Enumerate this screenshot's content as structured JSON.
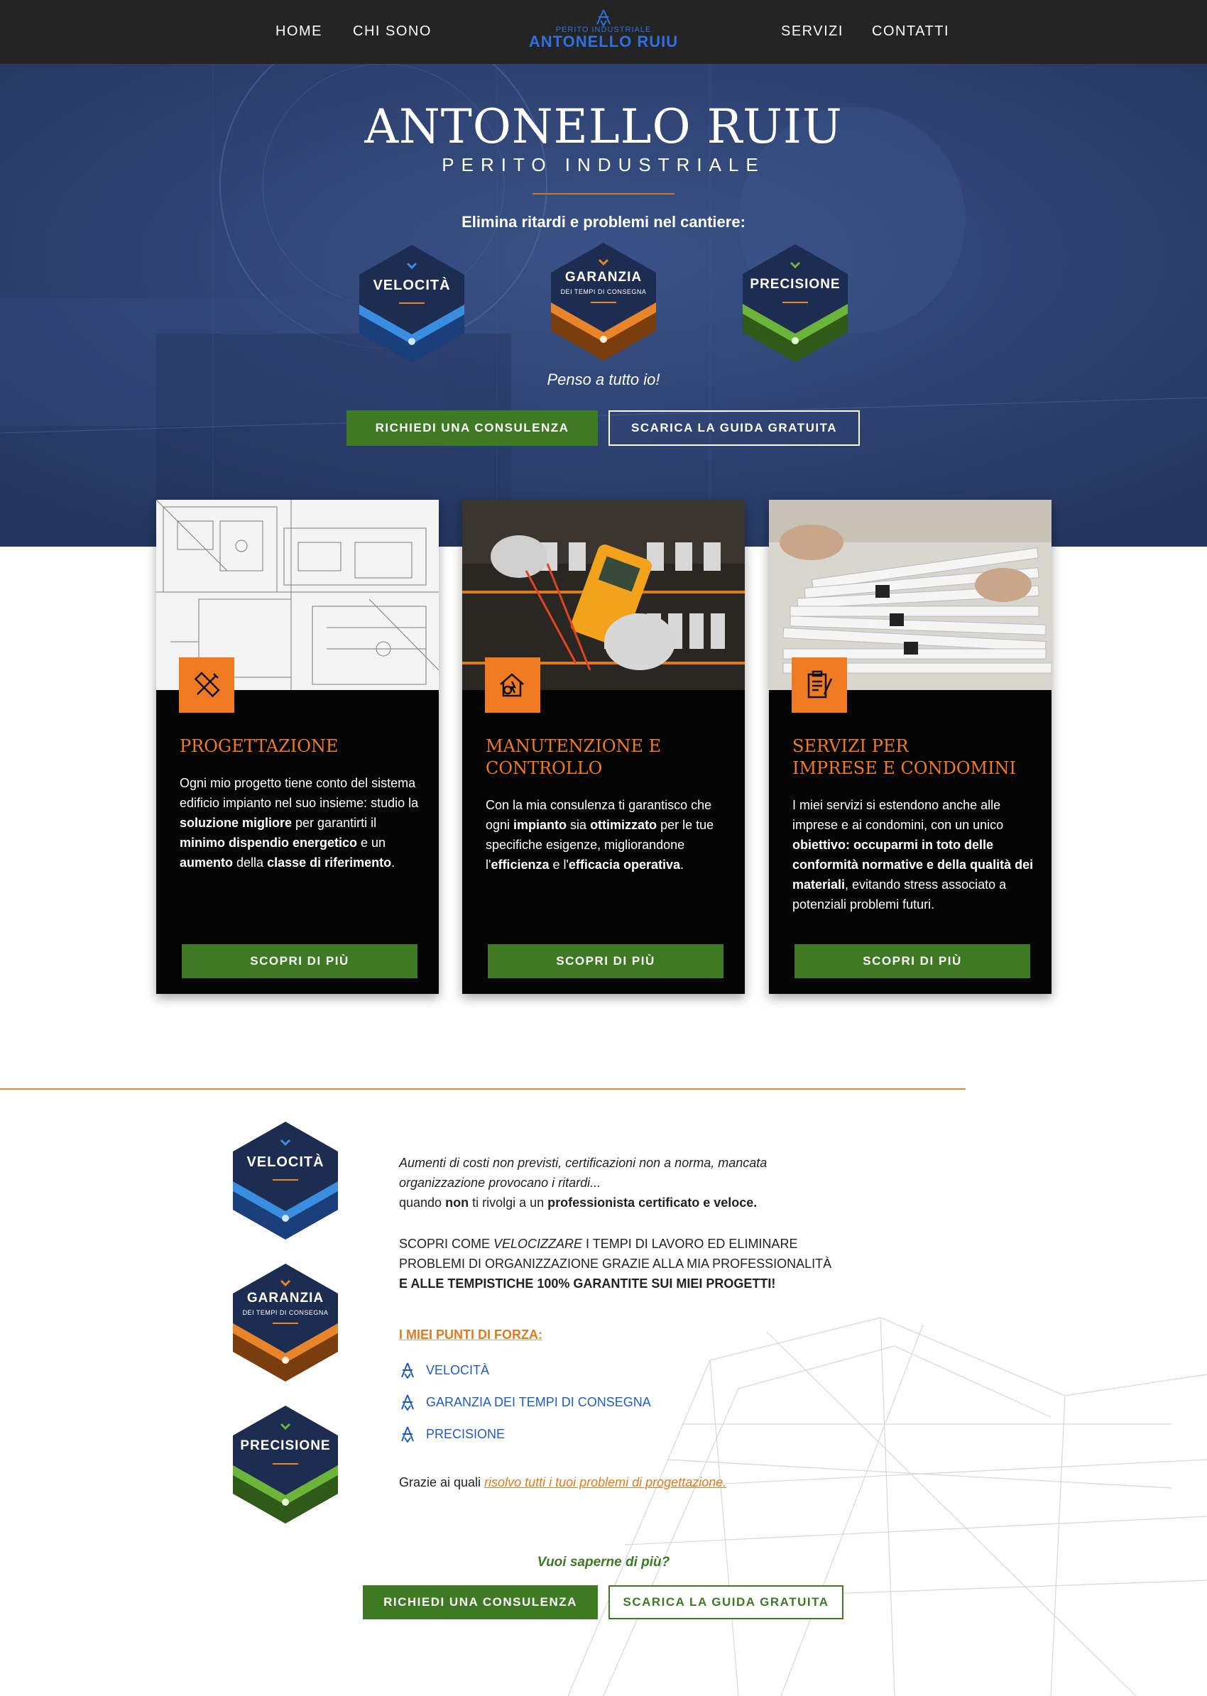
{
  "nav": {
    "home": "HOME",
    "chi_sono": "CHI SONO",
    "servizi": "SERVIZI",
    "contatti": "CONTATTI",
    "logo_small": "PERITO INDUSTRIALE",
    "logo_big": "ANTONELLO RUIU"
  },
  "hero": {
    "title": "ANTONELLO RUIU",
    "subtitle": "PERITO INDUSTRIALE",
    "tagline": "Elimina ritardi e problemi nel cantiere:",
    "closing": "Penso a tutto io!",
    "btn_consulenza": "RICHIEDI UNA CONSULENZA",
    "btn_guida": "SCARICA LA GUIDA GRATUITA"
  },
  "badges": {
    "velocita": {
      "title": "VELOCITÀ",
      "color": "#3b8de0"
    },
    "garanzia": {
      "title": "GARANZIA",
      "sub": "DEI TEMPI DI CONSEGNA",
      "color": "#e8842a"
    },
    "precisione": {
      "title": "PRECISIONE",
      "color": "#6db43a"
    }
  },
  "cards": [
    {
      "title": "PROGETTAZIONE",
      "icon": "ruler-pencil-icon",
      "button": "SCOPRI DI PIÙ"
    },
    {
      "title_line1": "MANUTENZIONE E",
      "title_line2": "CONTROLLO",
      "icon": "gear-house-icon",
      "button": "SCOPRI DI PIÙ"
    },
    {
      "title_line1": "SERVIZI PER",
      "title_line2": "IMPRESE E CONDOMINI",
      "icon": "clipboard-pen-icon",
      "button": "SCOPRI DI PIÙ"
    }
  ],
  "card_text": {
    "c1_a": "Ogni mio progetto tiene conto del sistema edificio impianto nel suo insieme: studio la ",
    "c1_b": "soluzione migliore",
    "c1_c": " per garantirti il ",
    "c1_d": "minimo dispendio energetico",
    "c1_e": " e un ",
    "c1_f": "aumento",
    "c1_g": " della ",
    "c1_h": "classe di riferimento",
    "c1_i": ".",
    "c2_a": "Con la mia consulenza ti garantisco che ogni ",
    "c2_b": "impianto",
    "c2_c": " sia ",
    "c2_d": "ottimizzato",
    "c2_e": " per le tue specifiche esigenze, migliorandone l'",
    "c2_f": "efficienza",
    "c2_g": " e l'",
    "c2_h": "efficacia operativa",
    "c2_i": ".",
    "c3_a": "I miei servizi si estendono anche alle imprese e ai condomini, con un unico ",
    "c3_b": "obiettivo: occuparmi in toto delle conformità normative e della qualità dei materiali",
    "c3_c": ", evitando stress associato a potenziali problemi futuri."
  },
  "section2": {
    "intro_italic": "Aumenti di costi non previsti, certificazioni non a norma, mancata organizzazione provocano i ritardi...",
    "intro_a": "quando ",
    "intro_b": "non",
    "intro_c": " ti rivolgi a un ",
    "intro_d": "professionista certificato e veloce.",
    "scopri_a": "SCOPRI COME ",
    "scopri_b": "VELOCIZZARE",
    "scopri_c": " I TEMPI DI LAVORO ED ELIMINARE PROBLEMI DI ORGANIZZAZIONE GRAZIE ALLA MIA PROFESSIONALITÀ",
    "scopri_d": "E ALLE TEMPISTICHE 100% GARANTITE SUI MIEI PROGETTI!",
    "punti_title": "I MIEI PUNTI DI FORZA:",
    "punti": [
      "VELOCITÀ",
      "GARANZIA DEI TEMPI DI CONSEGNA",
      "PRECISIONE"
    ],
    "grazie_a": "Grazie ai quali ",
    "grazie_link": "risolvo tutti i tuoi problemi di progettazione.",
    "vuoi": "Vuoi saperne di più?",
    "btn_consulenza": "RICHIEDI UNA CONSULENZA",
    "btn_guida": "SCARICA LA GUIDA GRATUITA"
  }
}
